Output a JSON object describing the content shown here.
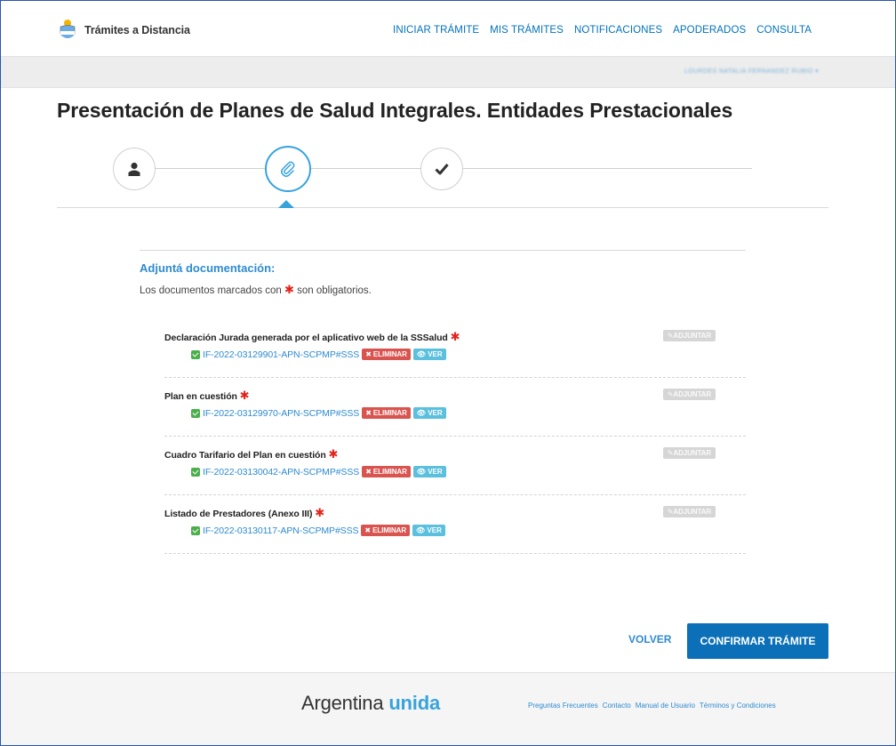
{
  "header": {
    "brand_name": "Trámites a Distancia",
    "nav": [
      "INICIAR TRÁMITE",
      "MIS TRÁMITES",
      "NOTIFICACIONES",
      "APODERADOS",
      "CONSULTA"
    ],
    "user_label": "LOURDES NATALIA FERNANDEZ RUBIO ▾"
  },
  "page": {
    "title": "Presentación de Planes de Salud Integrales. Entidades Prestacionales"
  },
  "stepper": {
    "steps": [
      {
        "icon": "user-icon",
        "active": false
      },
      {
        "icon": "paperclip-icon",
        "active": true
      },
      {
        "icon": "checkmark-icon",
        "active": false
      }
    ]
  },
  "documents": {
    "title": "Adjuntá documentación:",
    "note_before": "Los documentos marcados con",
    "required_mark": "✱",
    "note_after": "son obligatorios.",
    "attach_label": "ADJUNTAR",
    "delete_label": "ELIMINAR",
    "view_label": "VER",
    "items": [
      {
        "title": "Declaración Jurada generada por el aplicativo web de la SSSalud",
        "file": "IF-2022-03129901-APN-SCPMP#SSS"
      },
      {
        "title": "Plan en cuestión",
        "file": "IF-2022-03129970-APN-SCPMP#SSS"
      },
      {
        "title": "Cuadro Tarifario del Plan en cuestión",
        "file": "IF-2022-03130042-APN-SCPMP#SSS"
      },
      {
        "title": "Listado de Prestadores (Anexo III)",
        "file": "IF-2022-03130117-APN-SCPMP#SSS"
      }
    ]
  },
  "actions": {
    "back_label": "VOLVER",
    "confirm_label": "CONFIRMAR TRÁMITE"
  },
  "footer": {
    "brand_main": "Argentina",
    "brand_accent": "unida",
    "links": [
      "Preguntas Frecuentes",
      "Contacto",
      "Manual de Usuario",
      "Términos y Condiciones"
    ]
  },
  "colors": {
    "primary": "#0c70b8",
    "link": "#2e8bd0",
    "active_step": "#37a3dc",
    "danger": "#d9534f",
    "info": "#5bc0de",
    "success": "#4cae4c",
    "required": "#e2231a"
  }
}
